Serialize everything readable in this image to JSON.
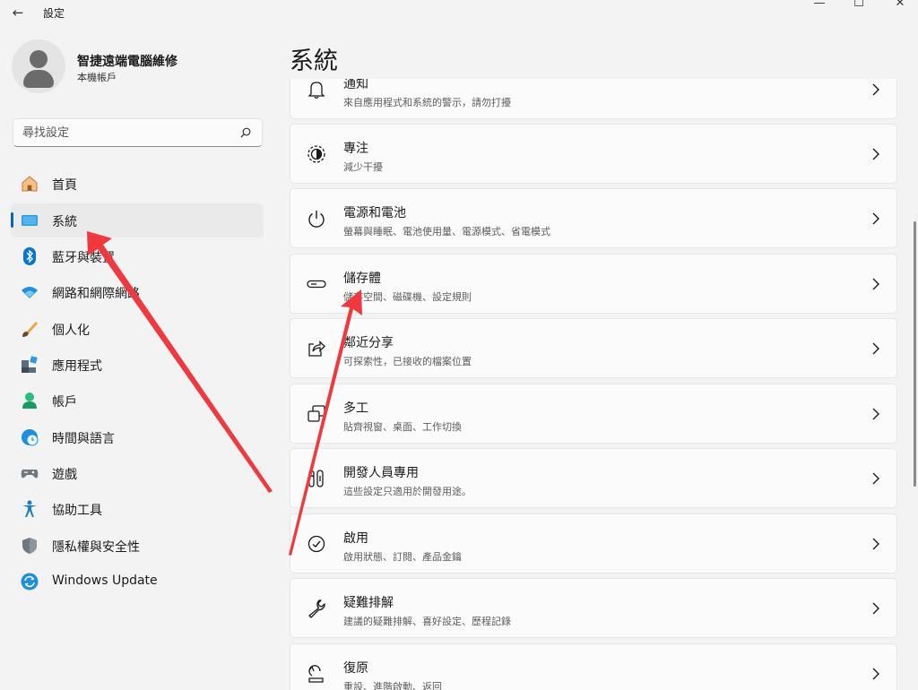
{
  "window": {
    "title": "設定",
    "back_glyph": "←",
    "minimize_glyph": "—",
    "maximize_glyph": "☐",
    "close_glyph": "✕"
  },
  "profile": {
    "name": "智捷遠端電腦維修",
    "account_type": "本機帳戶"
  },
  "search": {
    "placeholder": "尋找設定",
    "icon": "search-icon"
  },
  "sidebar": {
    "items": [
      {
        "label": "首頁",
        "icon": "home-icon",
        "active": false
      },
      {
        "label": "系統",
        "icon": "system-display-icon",
        "active": true
      },
      {
        "label": "藍牙與裝置",
        "icon": "bluetooth-icon",
        "active": false
      },
      {
        "label": "網路和網際網路",
        "icon": "wifi-icon",
        "active": false
      },
      {
        "label": "個人化",
        "icon": "brush-icon",
        "active": false
      },
      {
        "label": "應用程式",
        "icon": "apps-icon",
        "active": false
      },
      {
        "label": "帳戶",
        "icon": "account-icon",
        "active": false
      },
      {
        "label": "時間與語言",
        "icon": "time-language-icon",
        "active": false
      },
      {
        "label": "遊戲",
        "icon": "gamepad-icon",
        "active": false
      },
      {
        "label": "協助工具",
        "icon": "accessibility-icon",
        "active": false
      },
      {
        "label": "隱私權與安全性",
        "icon": "shield-icon",
        "active": false
      },
      {
        "label": "Windows Update",
        "icon": "windows-update-icon",
        "active": false
      }
    ]
  },
  "main": {
    "title": "系統",
    "cards": [
      {
        "title": "通知",
        "subtitle": "來自應用程式和系統的警示，請勿打擾",
        "icon": "bell-icon"
      },
      {
        "title": "專注",
        "subtitle": "減少干擾",
        "icon": "focus-icon"
      },
      {
        "title": "電源和電池",
        "subtitle": "螢幕與睡眠、電池使用量、電源模式、省電模式",
        "icon": "power-icon"
      },
      {
        "title": "儲存體",
        "subtitle": "儲存空間、磁碟機、設定規則",
        "icon": "storage-icon"
      },
      {
        "title": "鄰近分享",
        "subtitle": "可探索性，已接收的檔案位置",
        "icon": "share-icon"
      },
      {
        "title": "多工",
        "subtitle": "貼齊視窗、桌面、工作切換",
        "icon": "multitask-icon"
      },
      {
        "title": "開發人員專用",
        "subtitle": "這些設定只適用於開發用途。",
        "icon": "developer-icon"
      },
      {
        "title": "啟用",
        "subtitle": "啟用狀態、訂閱、產品金鑰",
        "icon": "activation-icon"
      },
      {
        "title": "疑難排解",
        "subtitle": "建議的疑難排解、喜好設定、歷程記錄",
        "icon": "wrench-icon"
      },
      {
        "title": "復原",
        "subtitle": "重設、進階啟動、返回",
        "icon": "recovery-icon"
      }
    ]
  },
  "colors": {
    "accent": "#0067c0",
    "annotation_arrow": "#f0393e",
    "background": "#f3f3f3",
    "card": "#fbfbfb"
  }
}
